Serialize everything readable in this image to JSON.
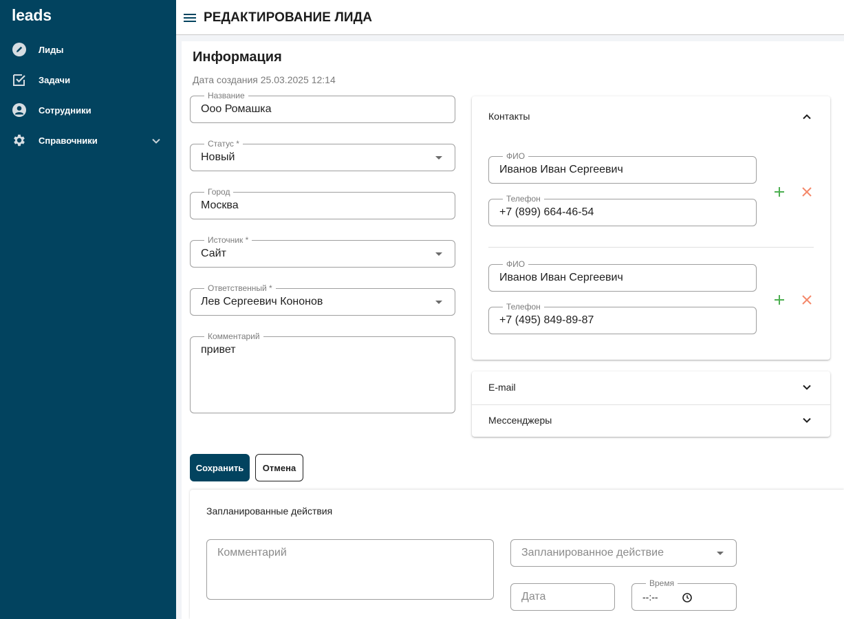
{
  "sidebar": {
    "logo": "leads",
    "items": [
      {
        "label": "Лиды",
        "icon": "pencil-circle-icon"
      },
      {
        "label": "Задачи",
        "icon": "checkbox-icon"
      },
      {
        "label": "Сотрудники",
        "icon": "account-circle-icon"
      },
      {
        "label": "Справочники",
        "icon": "gear-icon"
      }
    ]
  },
  "header": {
    "title": "РЕДАКТИРОВАНИЕ ЛИДА"
  },
  "info": {
    "title": "Информация",
    "created": "Дата создания 25.03.2025 12:14",
    "fields": {
      "name": {
        "label": "Название",
        "value": "Ооо Ромашка"
      },
      "status": {
        "label": "Статус *",
        "value": "Новый"
      },
      "city": {
        "label": "Город",
        "value": "Москва"
      },
      "source": {
        "label": "Источник *",
        "value": "Сайт"
      },
      "responsible": {
        "label": "Ответственный *",
        "value": "Лев Сергеевич Кононов"
      },
      "comment": {
        "label": "Комментарий",
        "value": "привет"
      }
    }
  },
  "contacts": {
    "title": "Контакты",
    "items": [
      {
        "fio_label": "ФИО",
        "fio": "Иванов Иван Сергеевич",
        "phone_label": "Телефон",
        "phone": "+7 (899) 664-46-54"
      },
      {
        "fio_label": "ФИО",
        "fio": "Иванов Иван Сергеевич",
        "phone_label": "Телефон",
        "phone": "+7 (495) 849-89-87"
      }
    ]
  },
  "email": {
    "title": "E-mail"
  },
  "messengers": {
    "title": "Мессенджеры"
  },
  "buttons": {
    "save": "Сохранить",
    "cancel": "Отмена"
  },
  "planned": {
    "title": "Запланированные действия",
    "comment_placeholder": "Комментарий",
    "action_placeholder": "Запланированное действие",
    "date_placeholder": "Дата",
    "time_label": "Время",
    "time_value": "--:--"
  },
  "colors": {
    "sidebar": "#02435f",
    "primary": "#02435f",
    "add": "#4caf50",
    "remove": "#f4886a"
  }
}
